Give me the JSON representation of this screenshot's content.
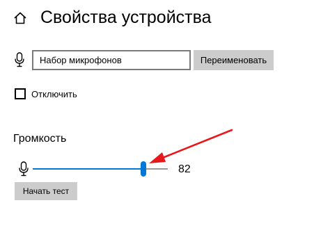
{
  "header": {
    "title": "Свойства устройства",
    "home_icon": "home-icon"
  },
  "device_name": {
    "icon": "microphone-icon",
    "value": "Набор микрофонов",
    "rename_label": "Переименовать"
  },
  "disable": {
    "label": "Отключить",
    "checked": false
  },
  "volume": {
    "heading": "Громкость",
    "icon": "microphone-icon",
    "value": "82",
    "level": 82,
    "max": 100
  },
  "test_button": {
    "label": "Начать тест"
  },
  "colors": {
    "accent": "#0078d7",
    "button_bg": "#cccccc",
    "annotation": "#e8171b"
  }
}
